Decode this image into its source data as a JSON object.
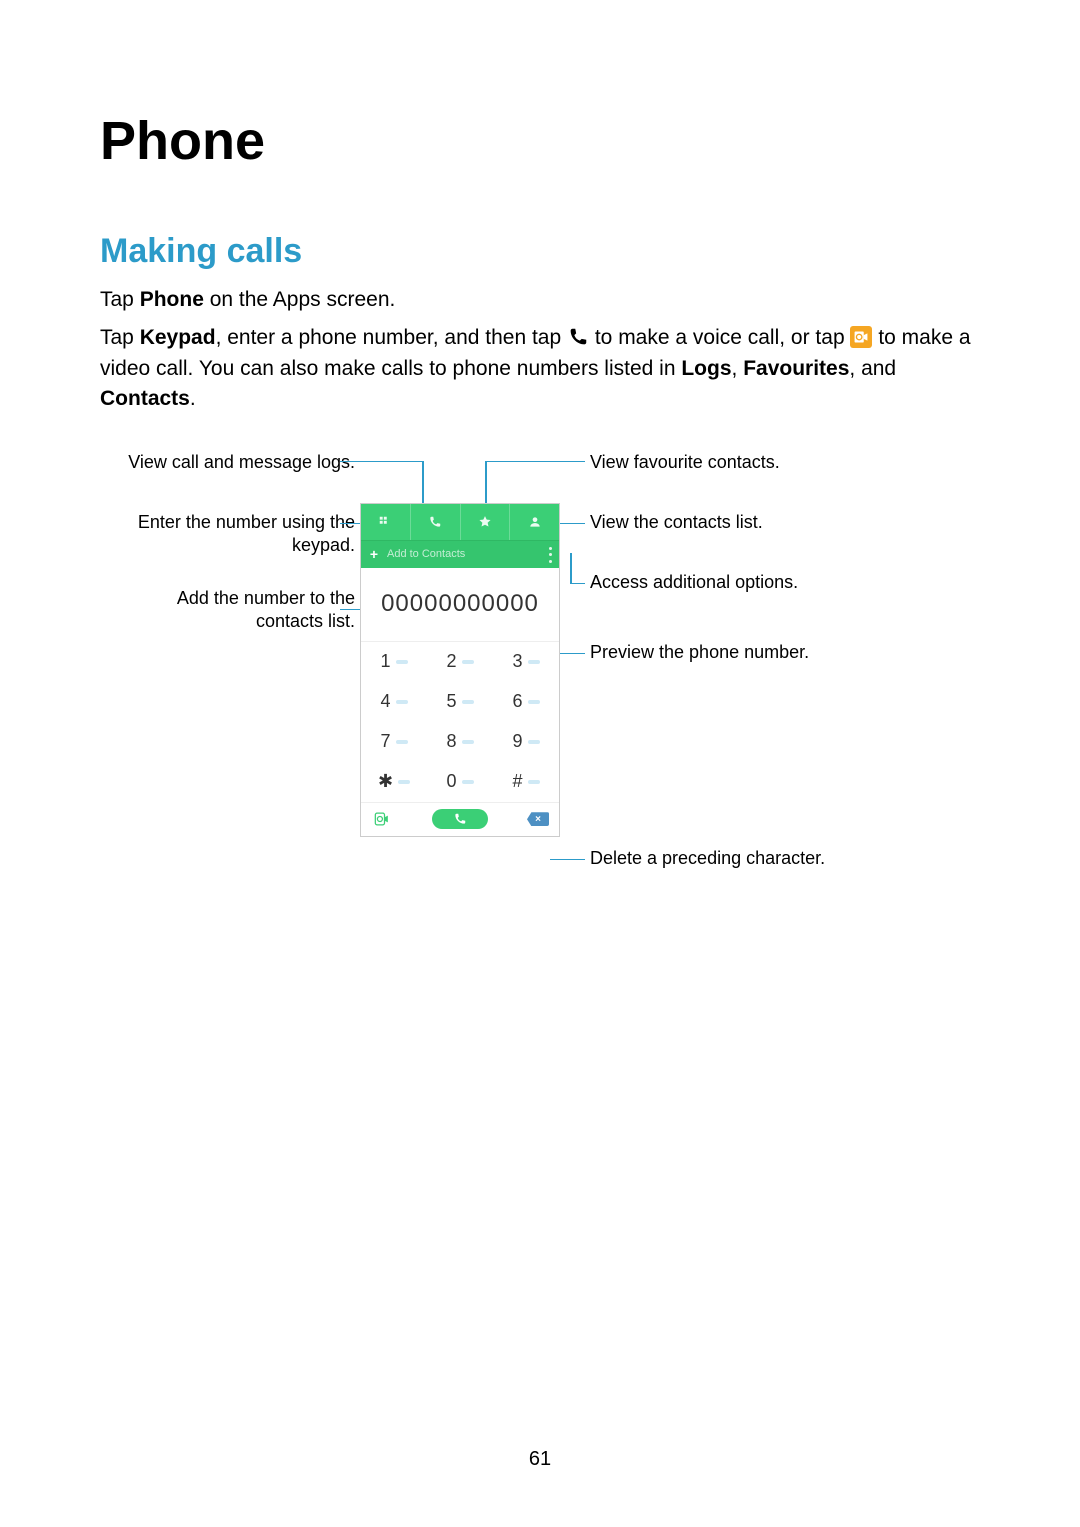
{
  "title": "Phone",
  "section_heading": "Making calls",
  "body": {
    "p1_a": "Tap ",
    "p1_b": "Phone",
    "p1_c": " on the Apps screen.",
    "p2_a": "Tap ",
    "p2_b": "Keypad",
    "p2_c": ", enter a phone number, and then tap ",
    "p2_d": " to make a voice call, or tap ",
    "p2_e": " to make a video call. You can also make calls to phone numbers listed in ",
    "p2_f": "Logs",
    "p2_g": ", ",
    "p2_h": "Favourites",
    "p2_i": ", and ",
    "p2_j": "Contacts",
    "p2_k": "."
  },
  "callouts": {
    "left": [
      "View call and message logs.",
      "Enter the number using the keypad.",
      "Add the number to the contacts list."
    ],
    "right": [
      "View favourite contacts.",
      "View the contacts list.",
      "Access additional options.",
      "Preview the phone number.",
      "Delete a preceding character."
    ]
  },
  "phone_ui": {
    "add_to_contacts": "Add to Contacts",
    "number_display": "00000000000",
    "keypad": [
      "1",
      "2",
      "3",
      "4",
      "5",
      "6",
      "7",
      "8",
      "9",
      "✱",
      "0",
      "#"
    ]
  },
  "page_number": "61"
}
